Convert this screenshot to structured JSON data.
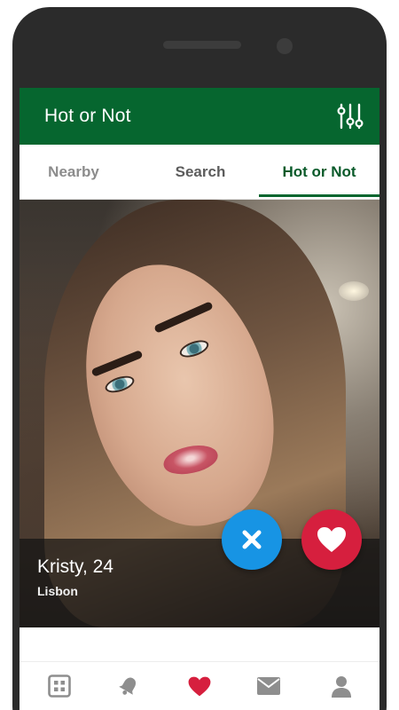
{
  "app": {
    "title": "Hot or Not"
  },
  "tabs": [
    {
      "label": "Nearby",
      "active": false
    },
    {
      "label": "Search",
      "active": false
    },
    {
      "label": "Hot or Not",
      "active": true
    }
  ],
  "profile": {
    "name_age": "Kristy, 24",
    "city": "Lisbon"
  },
  "actions": {
    "dislike_icon": "close-icon",
    "like_icon": "heart-icon"
  },
  "bottom_nav": [
    {
      "icon": "grid-icon",
      "active": false
    },
    {
      "icon": "bell-icon",
      "active": false
    },
    {
      "icon": "heart-icon",
      "active": true
    },
    {
      "icon": "mail-icon",
      "active": false
    },
    {
      "icon": "user-icon",
      "active": false
    }
  ],
  "colors": {
    "brand_green": "#06662f",
    "like_red": "#d61f3e",
    "dislike_blue": "#1794e4",
    "nav_icon_gray": "#8e8e8e"
  }
}
